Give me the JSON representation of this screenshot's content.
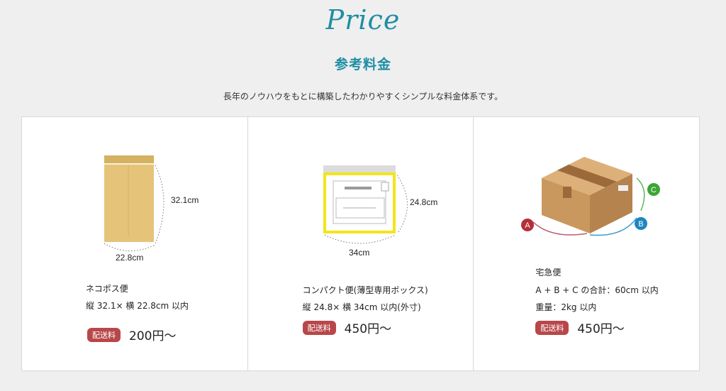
{
  "header": {
    "script_title": "Price",
    "jp_title": "参考料金",
    "lead": "長年のノウハウをもとに構築したわかりやすくシンプルな料金体系です。"
  },
  "cards": [
    {
      "name": "ネコポス便",
      "spec": "縦 32.1× 横 22.8cm 以内",
      "badge": "配送料",
      "price": "200円〜",
      "dim_height": "32.1cm",
      "dim_width": "22.8cm"
    },
    {
      "name": "コンパクト便(薄型専用ボックス)",
      "spec": "縦 24.8× 横 34cm 以内(外寸)",
      "badge": "配送料",
      "price": "450円〜",
      "dim_height": "24.8cm",
      "dim_width": "34cm"
    },
    {
      "name": "宅急便",
      "spec": "A + B + C の合計：60cm 以内",
      "spec2": "重量：2kg 以内",
      "badge": "配送料",
      "price": "450円〜",
      "labels": [
        "A",
        "B",
        "C"
      ]
    }
  ],
  "colors": {
    "accent": "#1e8ea3",
    "badge": "#b8474a",
    "envelope": "#e5c47a",
    "compact_frame": "#f3e41c",
    "box": "#c9985e",
    "label_a": "#b3303a",
    "label_b": "#1d86bf",
    "label_c": "#3aa636"
  }
}
